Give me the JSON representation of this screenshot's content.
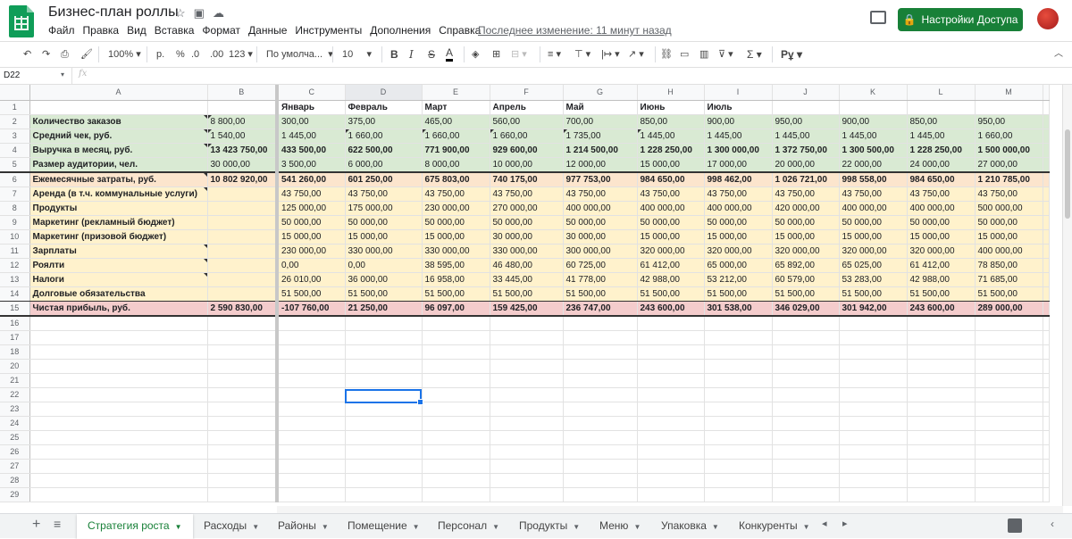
{
  "doc": {
    "title": "Бизнес-план роллы",
    "last_edit": "Последнее изменение: 11 минут назад",
    "share_label": "Настройки Доступа"
  },
  "menu": [
    "Файл",
    "Правка",
    "Вид",
    "Вставка",
    "Формат",
    "Данные",
    "Инструменты",
    "Дополнения",
    "Справка"
  ],
  "toolbar": {
    "zoom": "100%",
    "currency": "р.",
    "percent": "%",
    "dec_less": ".0",
    "dec_more": ".00",
    "more_formats": "123",
    "font": "По умолча...",
    "font_size": "10",
    "bold": "B",
    "italic": "I",
    "strike": "S",
    "text_color": "A",
    "sigma": "Σ",
    "input_tools": "Рұ"
  },
  "formula_bar": {
    "cell_ref": "D22",
    "fx": "fx",
    "value": ""
  },
  "columns": [
    "A",
    "B",
    "C",
    "D",
    "E",
    "F",
    "G",
    "H",
    "I",
    "J",
    "K",
    "L",
    "M"
  ],
  "rows": [
    {
      "n": "1",
      "fill": "",
      "cells": [
        "",
        "",
        "Январь",
        "Февраль",
        "Март",
        "Апрель",
        "Май",
        "Июнь",
        "Июль",
        "",
        "",
        "",
        ""
      ]
    },
    {
      "n": "2",
      "fill": "g",
      "cells": [
        "Количество заказов",
        "8 800,00",
        "300,00",
        "375,00",
        "465,00",
        "560,00",
        "700,00",
        "850,00",
        "900,00",
        "950,00",
        "900,00",
        "850,00",
        "950,00"
      ]
    },
    {
      "n": "3",
      "fill": "g",
      "cells": [
        "Средний чек, руб.",
        "1 540,00",
        "1 445,00",
        "1 660,00",
        "1 660,00",
        "1 660,00",
        "1 735,00",
        "1 445,00",
        "1 445,00",
        "1 445,00",
        "1 445,00",
        "1 445,00",
        "1 660,00"
      ]
    },
    {
      "n": "4",
      "fill": "g",
      "cells": [
        "Выручка в месяц, руб.",
        "13 423 750,00",
        "433 500,00",
        "622 500,00",
        "771 900,00",
        "929 600,00",
        "1 214 500,00",
        "1 228 250,00",
        "1 300 000,00",
        "1 372 750,00",
        "1 300 500,00",
        "1 228 250,00",
        "1 500 000,00"
      ]
    },
    {
      "n": "5",
      "fill": "g",
      "cells": [
        "Размер аудитории, чел.",
        "30 000,00",
        "3 500,00",
        "6 000,00",
        "8 000,00",
        "10 000,00",
        "12 000,00",
        "15 000,00",
        "17 000,00",
        "20 000,00",
        "22 000,00",
        "24 000,00",
        "27 000,00"
      ]
    },
    {
      "n": "6",
      "fill": "o",
      "cells": [
        "Ежемесячные затраты, руб.",
        "10 802 920,00",
        "541 260,00",
        "601 250,00",
        "675 803,00",
        "740 175,00",
        "977 753,00",
        "984 650,00",
        "998 462,00",
        "1 026 721,00",
        "998 558,00",
        "984 650,00",
        "1 210 785,00"
      ]
    },
    {
      "n": "7",
      "fill": "y",
      "cells": [
        "Аренда (в т.ч. коммунальные услуги)",
        "",
        "43 750,00",
        "43 750,00",
        "43 750,00",
        "43 750,00",
        "43 750,00",
        "43 750,00",
        "43 750,00",
        "43 750,00",
        "43 750,00",
        "43 750,00",
        "43 750,00"
      ]
    },
    {
      "n": "8",
      "fill": "y",
      "cells": [
        "Продукты",
        "",
        "125 000,00",
        "175 000,00",
        "230 000,00",
        "270 000,00",
        "400 000,00",
        "400 000,00",
        "400 000,00",
        "420 000,00",
        "400 000,00",
        "400 000,00",
        "500 000,00"
      ]
    },
    {
      "n": "9",
      "fill": "y",
      "cells": [
        "Маркетинг (рекламный бюджет)",
        "",
        "50 000,00",
        "50 000,00",
        "50 000,00",
        "50 000,00",
        "50 000,00",
        "50 000,00",
        "50 000,00",
        "50 000,00",
        "50 000,00",
        "50 000,00",
        "50 000,00"
      ]
    },
    {
      "n": "10",
      "fill": "y",
      "cells": [
        "Маркетинг (призовой бюджет)",
        "",
        "15 000,00",
        "15 000,00",
        "15 000,00",
        "30 000,00",
        "30 000,00",
        "15 000,00",
        "15 000,00",
        "15 000,00",
        "15 000,00",
        "15 000,00",
        "15 000,00"
      ]
    },
    {
      "n": "11",
      "fill": "y",
      "cells": [
        "Зарплаты",
        "",
        "230 000,00",
        "330 000,00",
        "330 000,00",
        "330 000,00",
        "300 000,00",
        "320 000,00",
        "320 000,00",
        "320 000,00",
        "320 000,00",
        "320 000,00",
        "400 000,00"
      ]
    },
    {
      "n": "12",
      "fill": "y",
      "cells": [
        "Роялти",
        "",
        "0,00",
        "0,00",
        "38 595,00",
        "46 480,00",
        "60 725,00",
        "61 412,00",
        "65 000,00",
        "65 892,00",
        "65 025,00",
        "61 412,00",
        "78 850,00"
      ]
    },
    {
      "n": "13",
      "fill": "y",
      "cells": [
        "Налоги",
        "",
        "26 010,00",
        "36 000,00",
        "16 958,00",
        "33 445,00",
        "41 778,00",
        "42 988,00",
        "53 212,00",
        "60 579,00",
        "53 283,00",
        "42 988,00",
        "71 685,00"
      ]
    },
    {
      "n": "14",
      "fill": "y",
      "cells": [
        "Долговые обязательства",
        "",
        "51 500,00",
        "51 500,00",
        "51 500,00",
        "51 500,00",
        "51 500,00",
        "51 500,00",
        "51 500,00",
        "51 500,00",
        "51 500,00",
        "51 500,00",
        "51 500,00"
      ]
    },
    {
      "n": "15",
      "fill": "r",
      "cells": [
        "Чистая прибыль, руб.",
        "2 590 830,00",
        "-107 760,00",
        "21 250,00",
        "96 097,00",
        "159 425,00",
        "236 747,00",
        "243 600,00",
        "301 538,00",
        "346 029,00",
        "301 942,00",
        "243 600,00",
        "289 000,00"
      ]
    },
    {
      "n": "16",
      "fill": "",
      "cells": [
        "",
        "",
        "",
        "",
        "",
        "",
        "",
        "",
        "",
        "",
        "",
        "",
        ""
      ]
    },
    {
      "n": "17",
      "fill": "",
      "cells": [
        "",
        "",
        "",
        "",
        "",
        "",
        "",
        "",
        "",
        "",
        "",
        "",
        ""
      ]
    },
    {
      "n": "18",
      "fill": "",
      "cells": [
        "",
        "",
        "",
        "",
        "",
        "",
        "",
        "",
        "",
        "",
        "",
        "",
        ""
      ]
    },
    {
      "n": "20",
      "fill": "",
      "cells": [
        "",
        "",
        "",
        "",
        "",
        "",
        "",
        "",
        "",
        "",
        "",
        "",
        ""
      ]
    },
    {
      "n": "21",
      "fill": "",
      "cells": [
        "",
        "",
        "",
        "",
        "",
        "",
        "",
        "",
        "",
        "",
        "",
        "",
        ""
      ]
    },
    {
      "n": "22",
      "fill": "",
      "cells": [
        "",
        "",
        "",
        "",
        "",
        "",
        "",
        "",
        "",
        "",
        "",
        "",
        ""
      ]
    },
    {
      "n": "23",
      "fill": "",
      "cells": [
        "",
        "",
        "",
        "",
        "",
        "",
        "",
        "",
        "",
        "",
        "",
        "",
        ""
      ]
    },
    {
      "n": "24",
      "fill": "",
      "cells": [
        "",
        "",
        "",
        "",
        "",
        "",
        "",
        "",
        "",
        "",
        "",
        "",
        ""
      ]
    },
    {
      "n": "25",
      "fill": "",
      "cells": [
        "",
        "",
        "",
        "",
        "",
        "",
        "",
        "",
        "",
        "",
        "",
        "",
        ""
      ]
    },
    {
      "n": "26",
      "fill": "",
      "cells": [
        "",
        "",
        "",
        "",
        "",
        "",
        "",
        "",
        "",
        "",
        "",
        "",
        ""
      ]
    },
    {
      "n": "27",
      "fill": "",
      "cells": [
        "",
        "",
        "",
        "",
        "",
        "",
        "",
        "",
        "",
        "",
        "",
        "",
        ""
      ]
    },
    {
      "n": "28",
      "fill": "",
      "cells": [
        "",
        "",
        "",
        "",
        "",
        "",
        "",
        "",
        "",
        "",
        "",
        "",
        ""
      ]
    },
    {
      "n": "29",
      "fill": "",
      "cells": [
        "",
        "",
        "",
        "",
        "",
        "",
        "",
        "",
        "",
        "",
        "",
        "",
        ""
      ]
    }
  ],
  "sheets": [
    "Стратегия роста",
    "Расходы",
    "Районы",
    "Помещение",
    "Персонал",
    "Продукты",
    "Меню",
    "Упаковка",
    "Конкуренты"
  ],
  "active_sheet": "Стратегия роста",
  "colors": {
    "green": "#d9ead3",
    "orange": "#fce5cd",
    "yellow": "#fff2cc",
    "red": "#f4cccc",
    "accent": "#188038",
    "selection": "#1a73e8"
  }
}
